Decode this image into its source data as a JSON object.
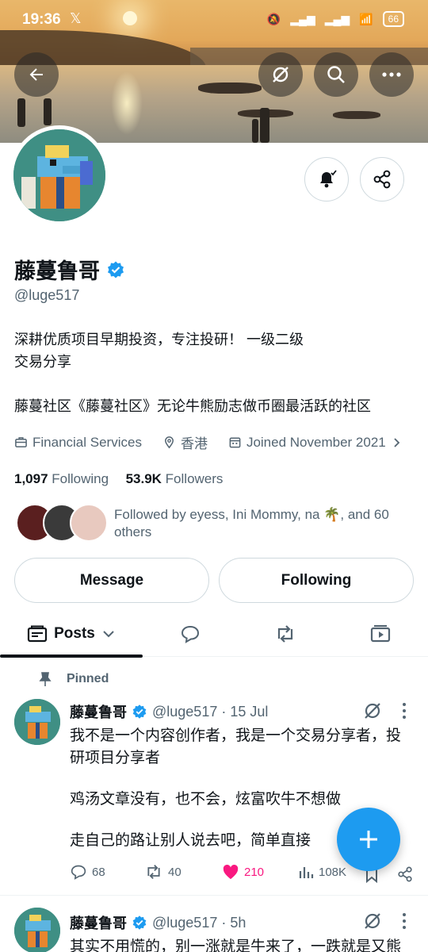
{
  "status_bar": {
    "time": "19:36",
    "battery": "66"
  },
  "profile": {
    "name": "藤蔓鲁哥",
    "handle": "@luge517",
    "bio_line1": "深耕优质项目早期投资，专注投研！ 一级二级",
    "bio_line2": "交易分享",
    "bio_line3": "藤蔓社区《藤蔓社区》无论牛熊励志做币圈最活跃的社区",
    "category": "Financial Services",
    "location": "香港",
    "joined": "Joined November 2021",
    "following_count": "1,097",
    "following_label": "Following",
    "followers_count": "53.9K",
    "followers_label": "Followers",
    "followed_by": "Followed by eyess, Ini Mommy, na 🌴, and 60 others"
  },
  "buttons": {
    "message": "Message",
    "following": "Following"
  },
  "tabs": {
    "posts": "Posts"
  },
  "pinned_label": "Pinned",
  "posts": [
    {
      "name": "藤蔓鲁哥",
      "handle_time": "@luge517 · 15 Jul",
      "lines": [
        "我不是一个内容创作者，我是一个交易分享者，投",
        "研项目分享者",
        "鸡汤文章没有，也不会，炫富吹牛不想做",
        "走自己的路让别人说去吧，简单直接"
      ],
      "replies": "68",
      "reposts": "40",
      "likes": "210",
      "views": "108K"
    },
    {
      "name": "藤蔓鲁哥",
      "handle_time": "@luge517 · 5h",
      "lines": [
        "其实不用慌的，别一涨就是牛来了，一跌就是又熊"
      ]
    }
  ],
  "colors": {
    "accent": "#1d9bf0",
    "like": "#f91880",
    "verified": "#1d9bf0"
  }
}
